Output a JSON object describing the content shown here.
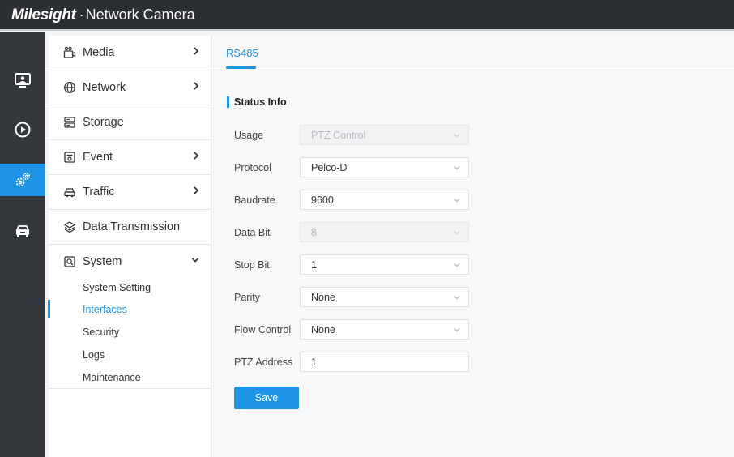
{
  "header": {
    "brand_logo": "Milesight",
    "brand_sep": "·",
    "brand_product": "Network Camera"
  },
  "rail": {
    "items": [
      {
        "icon": "live-view-icon",
        "active": false
      },
      {
        "icon": "playback-icon",
        "active": false
      },
      {
        "icon": "settings-gears-icon",
        "active": true
      },
      {
        "icon": "vehicle-icon",
        "active": false
      }
    ]
  },
  "nav": {
    "items": [
      {
        "label": "Media",
        "icon": "media-camera-icon",
        "chevron": "right"
      },
      {
        "label": "Network",
        "icon": "globe-icon",
        "chevron": "right"
      },
      {
        "label": "Storage",
        "icon": "storage-icon",
        "chevron": "none"
      },
      {
        "label": "Event",
        "icon": "event-icon",
        "chevron": "right"
      },
      {
        "label": "Traffic",
        "icon": "car-icon",
        "chevron": "right"
      },
      {
        "label": "Data Transmission",
        "icon": "layers-icon",
        "chevron": "none"
      },
      {
        "label": "System",
        "icon": "system-icon",
        "chevron": "down"
      }
    ],
    "system_sub": [
      {
        "label": "System Setting",
        "active": false
      },
      {
        "label": "Interfaces",
        "active": true
      },
      {
        "label": "Security",
        "active": false
      },
      {
        "label": "Logs",
        "active": false
      },
      {
        "label": "Maintenance",
        "active": false
      }
    ]
  },
  "content": {
    "tab": "RS485",
    "section_title": "Status Info",
    "fields": [
      {
        "label": "Usage",
        "value": "PTZ Control",
        "type": "select",
        "disabled": true
      },
      {
        "label": "Protocol",
        "value": "Pelco-D",
        "type": "select",
        "disabled": false
      },
      {
        "label": "Baudrate",
        "value": "9600",
        "type": "select",
        "disabled": false
      },
      {
        "label": "Data Bit",
        "value": "8",
        "type": "select",
        "disabled": true
      },
      {
        "label": "Stop Bit",
        "value": "1",
        "type": "select",
        "disabled": false
      },
      {
        "label": "Parity",
        "value": "None",
        "type": "select",
        "disabled": false
      },
      {
        "label": "Flow Control",
        "value": "None",
        "type": "select",
        "disabled": false
      },
      {
        "label": "PTZ Address",
        "value": "1",
        "type": "input",
        "disabled": false
      }
    ],
    "save_label": "Save"
  },
  "colors": {
    "accent": "#1e94e6",
    "topbar": "#2b2e33",
    "rail": "#34373c"
  }
}
